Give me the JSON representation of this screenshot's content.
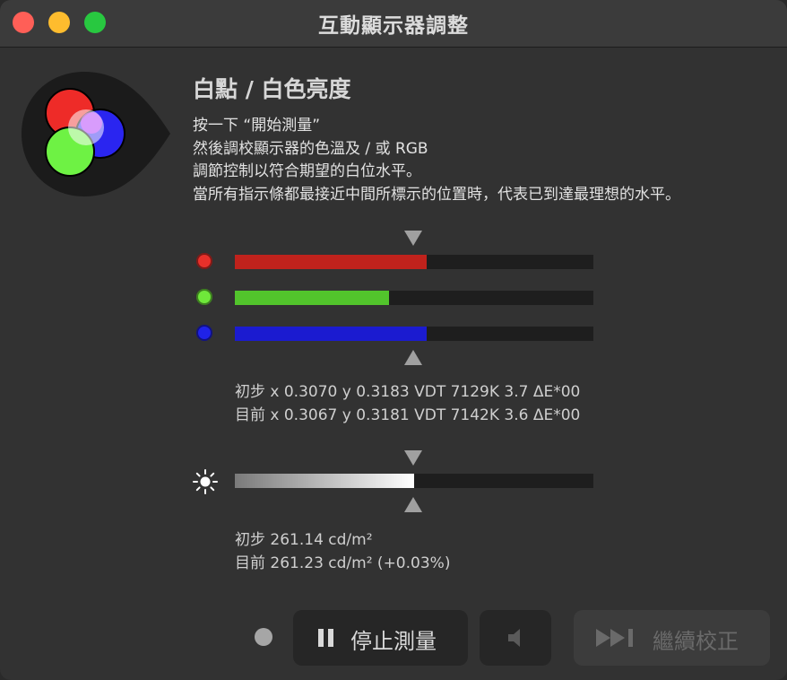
{
  "window": {
    "title": "互動顯示器調整"
  },
  "section": {
    "title": "白點 / 白色亮度",
    "instructions": [
      "按一下 “開始測量”",
      "然後調校顯示器的色溫及 / 或 RGB",
      "調節控制以符合期望的白位水平。",
      "當所有指示條都最接近中間所標示的位置時，代表已到達最理想的水平。"
    ]
  },
  "rgb_bars": {
    "target_fraction": 0.5,
    "bars": [
      {
        "channel": "red",
        "dot_color": "#e8302a",
        "fill_color": "#c0221c",
        "level_fraction": 0.535
      },
      {
        "channel": "green",
        "dot_color": "#6fe83a",
        "fill_color": "#52c42c",
        "level_fraction": 0.43
      },
      {
        "channel": "blue",
        "dot_color": "#1f22e8",
        "fill_color": "#1b1bd0",
        "level_fraction": 0.535
      }
    ]
  },
  "chromaticity": {
    "initial": "初步 x 0.3070 y 0.3183 VDT 7129K 3.7 ΔE*00",
    "current": "目前 x 0.3067 y 0.3181 VDT 7142K 3.6 ΔE*00"
  },
  "luminance_bar": {
    "icon": "brightness-icon",
    "level_fraction": 0.5,
    "target_fraction": 0.5
  },
  "luminance": {
    "initial": "初步 261.14 cd/m²",
    "current": "目前 261.23 cd/m² (+0.03%)"
  },
  "controls": {
    "stop_label": "停止測量",
    "continue_label": "繼續校正",
    "stop_icon": "pause-icon",
    "sound_icon": "speaker-icon",
    "continue_icon": "skip-forward-icon",
    "status_icon": "record-indicator-icon"
  }
}
